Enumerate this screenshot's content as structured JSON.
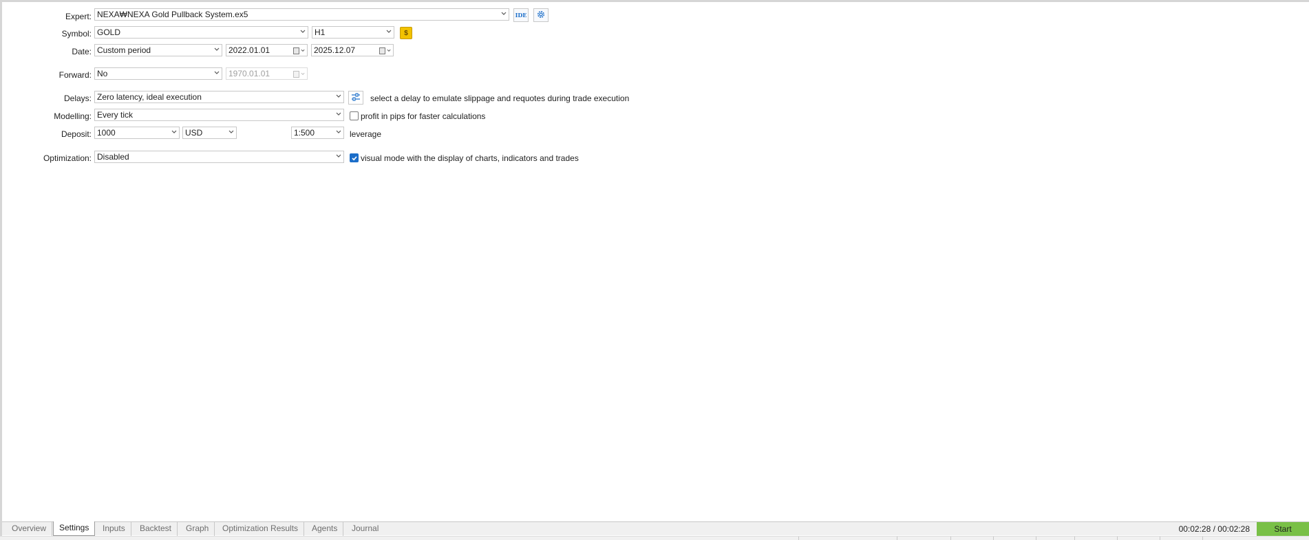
{
  "settings": {
    "expert": {
      "label": "Expert:",
      "value": "NEXA₩NEXA Gold Pullback System.ex5"
    },
    "symbol": {
      "label": "Symbol:",
      "value": "GOLD",
      "period": "H1"
    },
    "date": {
      "label": "Date:",
      "mode": "Custom period",
      "from": "2022.01.01",
      "to": "2025.12.07"
    },
    "forward": {
      "label": "Forward:",
      "value": "No",
      "date": "1970.01.01"
    },
    "delays": {
      "label": "Delays:",
      "value": "Zero latency, ideal execution",
      "hint": "select a delay to emulate slippage and requotes during trade execution"
    },
    "modelling": {
      "label": "Modelling:",
      "value": "Every tick",
      "option_label": "profit in pips for faster calculations",
      "option_checked": false
    },
    "deposit": {
      "label": "Deposit:",
      "amount": "1000",
      "currency": "USD",
      "leverage": "1:500",
      "leverage_label": "leverage"
    },
    "optimization": {
      "label": "Optimization:",
      "value": "Disabled",
      "option_label": "visual mode with the display of charts, indicators and trades",
      "option_checked": true
    }
  },
  "buttons": {
    "ide": "IDE",
    "symbol_props": "$"
  },
  "tabs": [
    "Overview",
    "Settings",
    "Inputs",
    "Backtest",
    "Graph",
    "Optimization Results",
    "Agents",
    "Journal"
  ],
  "active_tab": "Settings",
  "timer": "00:02:28 / 00:02:28",
  "start_label": "Start",
  "colors": {
    "accent": "#1c6ec9",
    "start_button": "#79c047",
    "gold_button": "#f2c200"
  }
}
